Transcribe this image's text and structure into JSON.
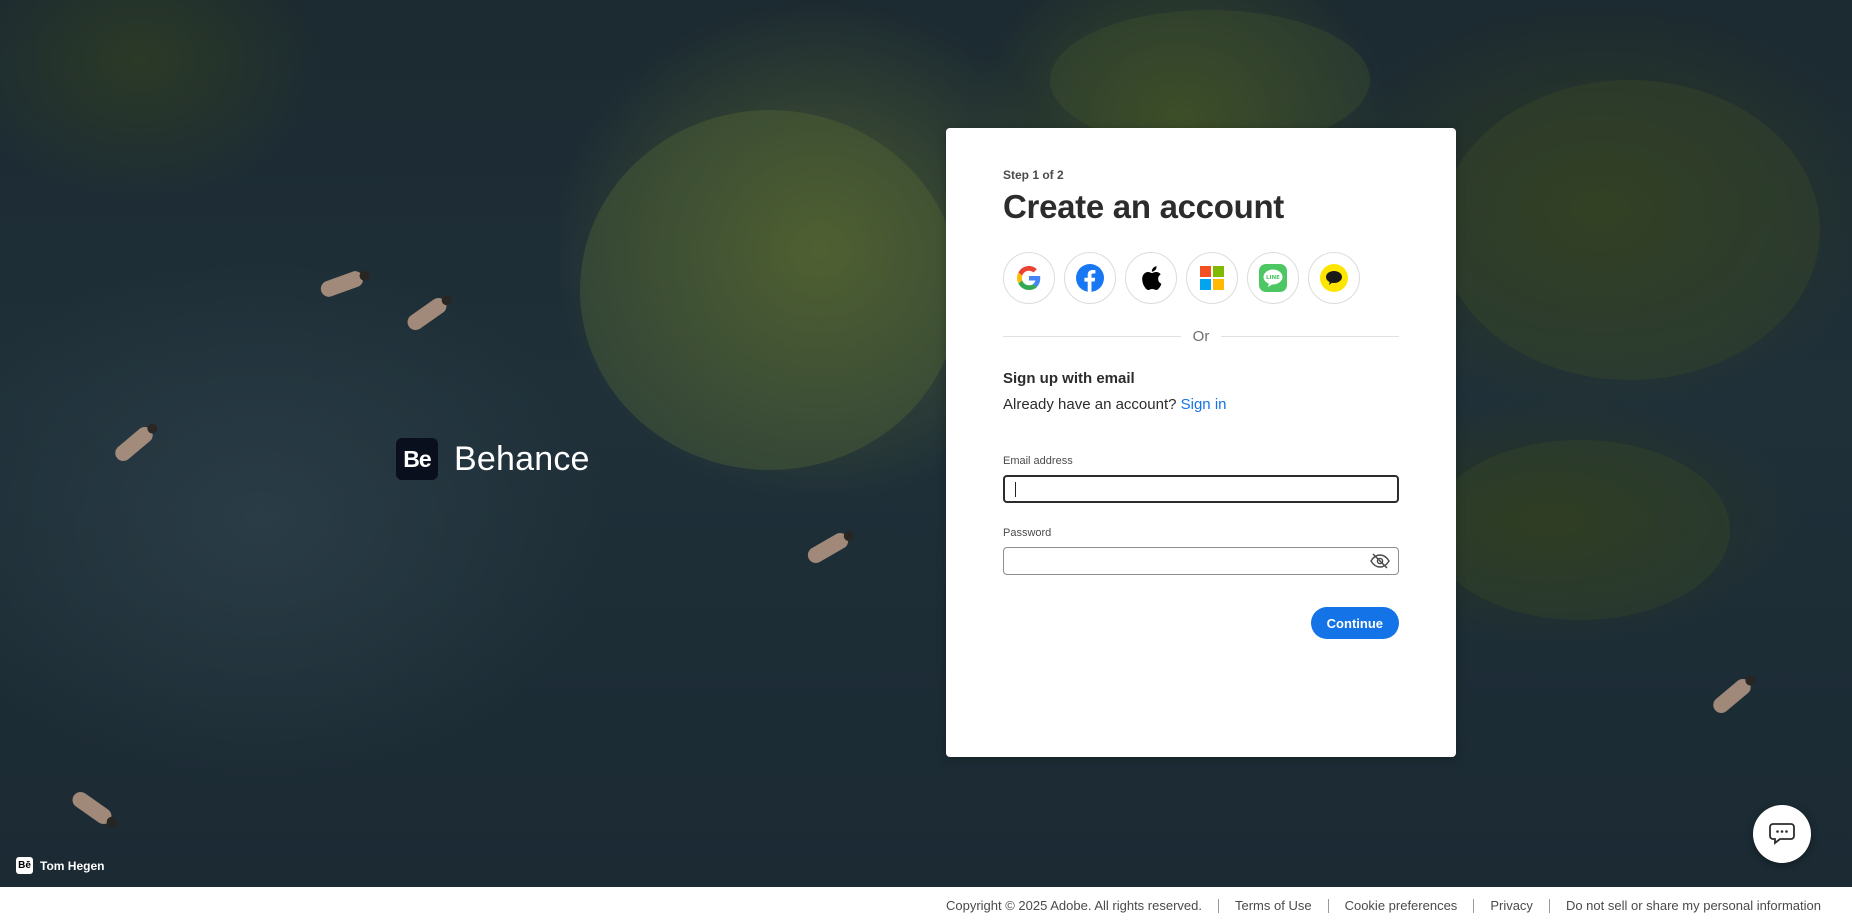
{
  "brand": {
    "badge": "Be",
    "name": "Behance"
  },
  "credit": {
    "badge": "Bē",
    "name": "Tom Hegen"
  },
  "card": {
    "step": "Step 1 of 2",
    "title": "Create an account",
    "socials": [
      {
        "name": "google",
        "icon": "google-icon"
      },
      {
        "name": "facebook",
        "icon": "facebook-icon",
        "color": "#1877F2"
      },
      {
        "name": "apple",
        "icon": "apple-icon",
        "color": "#000000"
      },
      {
        "name": "microsoft",
        "icon": "microsoft-icon"
      },
      {
        "name": "line",
        "icon": "line-icon",
        "color": "#4CC764"
      },
      {
        "name": "kakao",
        "icon": "kakao-icon",
        "color": "#FEE500"
      }
    ],
    "divider_label": "Or",
    "sub_heading": "Sign up with email",
    "have_account": "Already have an account?",
    "sign_in": "Sign in",
    "email_label": "Email address",
    "email_value": "",
    "password_label": "Password",
    "password_value": "",
    "continue_label": "Continue"
  },
  "colors": {
    "accent": "#1473E6",
    "brand_badge": "#0A0F1E"
  },
  "footer": {
    "copyright": "Copyright © 2025 Adobe. All rights reserved.",
    "terms": "Terms of Use",
    "cookies": "Cookie preferences",
    "privacy": "Privacy",
    "do_not_sell": "Do not sell or share my personal information"
  },
  "chat": {
    "icon": "chat-icon"
  }
}
